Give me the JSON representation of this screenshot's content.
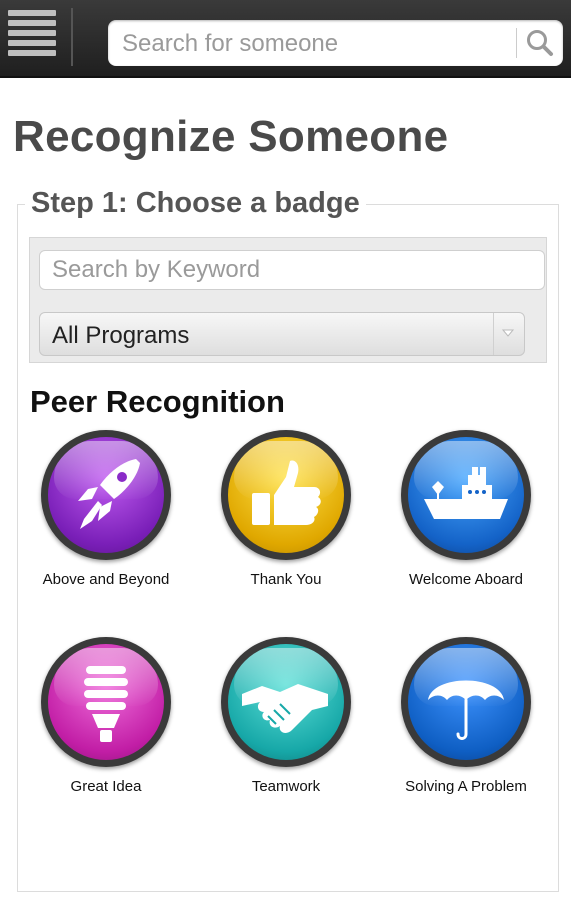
{
  "header": {
    "search_placeholder": "Search for someone"
  },
  "page": {
    "title": "Recognize Someone",
    "step_title": "Step 1: Choose a badge"
  },
  "filters": {
    "keyword_placeholder": "Search by Keyword",
    "program_selected": "All Programs"
  },
  "section": {
    "title": "Peer Recognition"
  },
  "badges": [
    {
      "label": "Above and Beyond",
      "icon": "rocket-icon",
      "color": "#8a2bc8"
    },
    {
      "label": "Thank You",
      "icon": "thumbs-up-icon",
      "color": "#e0b400"
    },
    {
      "label": "Welcome Aboard",
      "icon": "ship-icon",
      "color": "#1463c8"
    },
    {
      "label": "Great Idea",
      "icon": "lightbulb-icon",
      "color": "#c21ea6"
    },
    {
      "label": "Teamwork",
      "icon": "handshake-icon",
      "color": "#17a8a8"
    },
    {
      "label": "Solving A Problem",
      "icon": "umbrella-icon",
      "color": "#0f5fc4"
    }
  ]
}
